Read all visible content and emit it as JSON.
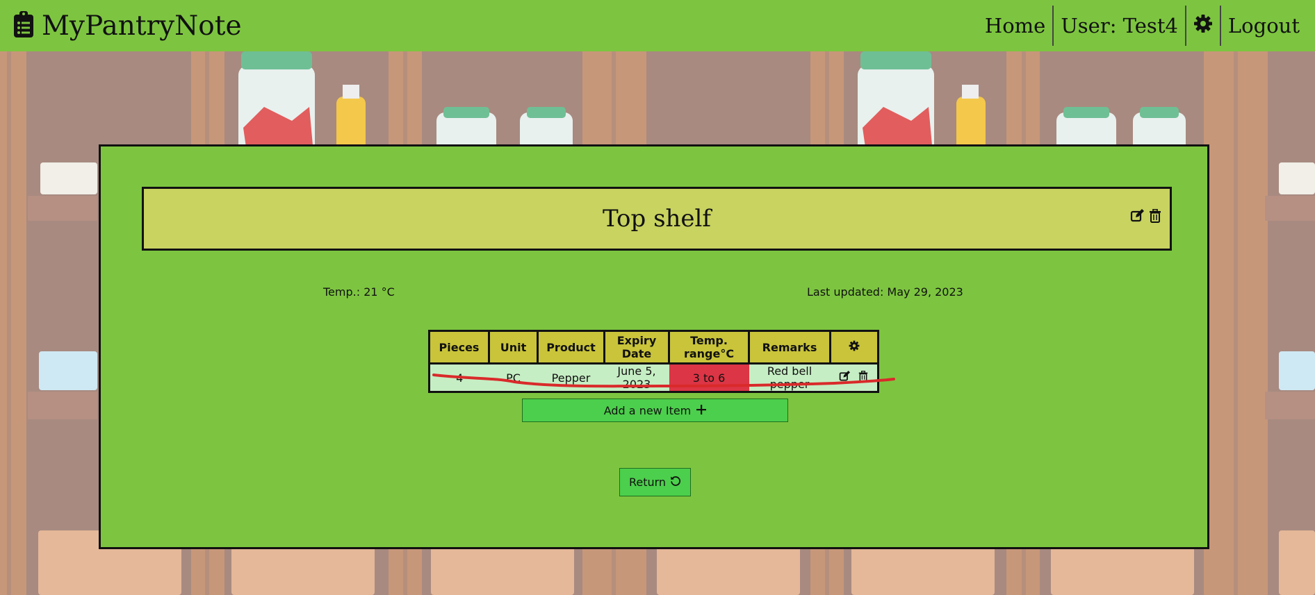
{
  "navbar": {
    "brand": "MyPantryNote",
    "brand_icon": "clipboard-list-icon",
    "home_label": "Home",
    "user_label": "User: Test4",
    "settings_icon": "gear-icon",
    "logout_label": "Logout",
    "color": "#7dc540"
  },
  "shelf": {
    "title": "Top shelf",
    "edit_icon": "edit-icon",
    "delete_icon": "trash-icon",
    "temp_text": "Temp.: 21 °C",
    "updated_text": "Last updated: May 29, 2023"
  },
  "table": {
    "headers": [
      "Pieces",
      "Unit",
      "Product",
      "Expiry Date",
      "Temp. range°C",
      "Remarks"
    ],
    "settings_header_icon": "gear-icon",
    "rows": [
      {
        "pieces": "4",
        "unit": "PC",
        "product": "Pepper",
        "expiry": "June 5, 2023",
        "temp_range": "3 to 6",
        "remarks": "Red bell pepper",
        "temp_alert_color": "#dc3545"
      }
    ]
  },
  "buttons": {
    "add_label": "Add a new Item",
    "add_icon": "plus-icon",
    "return_label": "Return",
    "return_icon": "rotate-icon"
  }
}
